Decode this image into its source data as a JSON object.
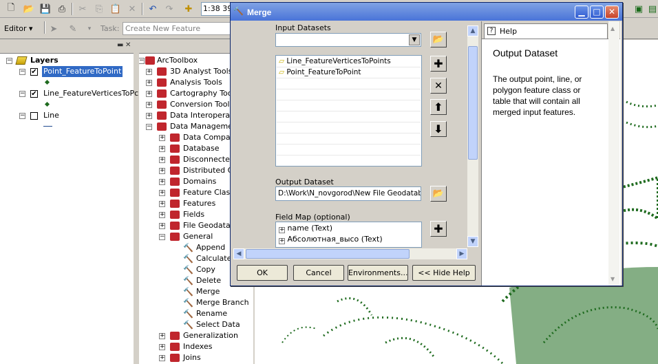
{
  "toolbar": {
    "scale_value": "1:38 39",
    "editor_label": "Editor",
    "task_label": "Task:",
    "task_value": "Create New Feature"
  },
  "toc": {
    "root_label": "Layers",
    "layers": [
      {
        "name": "Point_FeatureToPoint",
        "checked": true,
        "selected": true
      },
      {
        "name": "Line_FeatureVerticesToPc",
        "checked": true,
        "selected": false
      },
      {
        "name": "Line",
        "checked": false,
        "selected": false
      }
    ]
  },
  "toolbox": {
    "root": "ArcToolbox",
    "top_items": [
      "3D Analyst Tools",
      "Analysis Tools",
      "Cartography Tools",
      "Conversion Tools",
      "Data Interoperabi",
      "Data Management"
    ],
    "dm_items": [
      "Data Comparis",
      "Database",
      "Disconnected",
      "Distributed Ge",
      "Domains",
      "Feature Class",
      "Features",
      "Fields",
      "File Geodatab",
      "General"
    ],
    "general_tools": [
      "Append",
      "Calculate",
      "Copy",
      "Delete",
      "Merge",
      "Merge Branch",
      "Rename",
      "Select Data"
    ],
    "after_items": [
      "Generalization",
      "Indexes",
      "Joins"
    ]
  },
  "merge": {
    "title": "Merge",
    "input_label": "Input Datasets",
    "input_list": [
      "Line_FeatureVerticesToPoints",
      "Point_FeatureToPoint"
    ],
    "output_label": "Output Dataset",
    "output_value": "D:\\Work\\N_novgorod\\New File Geodataba",
    "fieldmap_label": "Field Map (optional)",
    "fieldmap_items": [
      "name (Text)",
      "Абсолютная_высо (Text)"
    ],
    "buttons": {
      "ok": "OK",
      "cancel": "Cancel",
      "env": "Environments...",
      "hide": "<< Hide Help"
    },
    "help_tab": "Help",
    "help_title": "Output Dataset",
    "help_text": "The output point, line, or polygon feature class or table that will contain all merged input features."
  },
  "colors": {
    "title_bar": "#4a74d8",
    "selection": "#316ac5",
    "feature": "#1f6b1f",
    "toolbox_red": "#c0262d"
  }
}
